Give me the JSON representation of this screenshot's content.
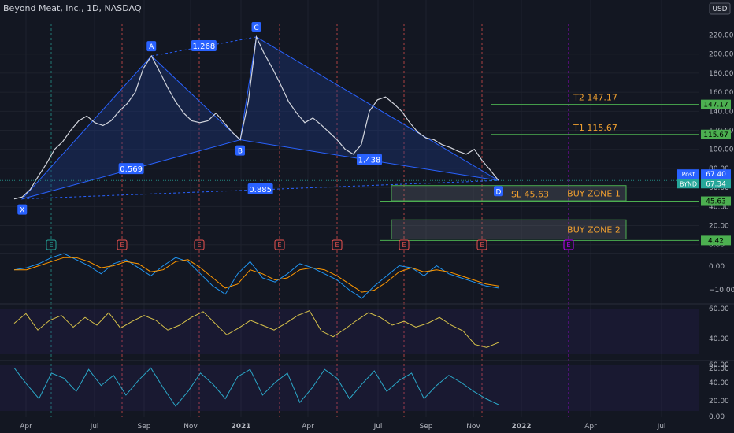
{
  "header": {
    "symbol_title": "Beyond Meat, Inc., 1D, NASDAQ",
    "currency": "USD"
  },
  "colors": {
    "background": "#131722",
    "candle_up": "#26a69a",
    "candle_down": "#ef5350",
    "pattern_line": "#2962ff",
    "pattern_fill": "#1e3a8a",
    "target_line": "#4caf50",
    "zone_label": "#f0a030",
    "macd_line": "#2196f3",
    "signal_line": "#ff9800",
    "rsi_line": "#d8c34a",
    "stoch_line": "#2ba8c8",
    "earnings_marker": "#ef5350",
    "earnings_upcoming": "#c000ff"
  },
  "chart_data": [
    {
      "type": "line",
      "title": "Beyond Meat, Inc., 1D, NASDAQ",
      "x_labels": [
        "Apr",
        "Jul",
        "Sep",
        "Nov",
        "2021",
        "Apr",
        "Jul",
        "Sep",
        "Nov",
        "2022",
        "Apr",
        "Jul"
      ],
      "y_ticks": [
        0,
        20,
        40,
        60,
        80,
        100,
        120,
        140,
        160,
        180,
        200,
        220
      ],
      "ylim": [
        -6,
        232
      ],
      "series": [
        {
          "values": [
            48,
            50,
            58,
            72,
            85,
            100,
            108,
            120,
            130,
            135,
            128,
            125,
            130,
            140,
            148,
            160,
            185,
            198,
            182,
            165,
            150,
            138,
            130,
            128,
            130,
            138,
            128,
            118,
            110,
            150,
            218,
            200,
            185,
            168,
            150,
            138,
            128,
            133,
            126,
            118,
            110,
            100,
            95,
            105,
            140,
            152,
            155,
            148,
            140,
            128,
            118,
            112,
            110,
            105,
            102,
            98,
            95,
            100,
            88,
            78,
            67.34
          ]
        }
      ],
      "harmonic_pattern": {
        "points": [
          {
            "label": "X",
            "value": 48
          },
          {
            "label": "A",
            "value": 198
          },
          {
            "label": "B",
            "value": 110
          },
          {
            "label": "C",
            "value": 218
          },
          {
            "label": "D",
            "value": 67.34
          }
        ],
        "ratios": [
          {
            "label": "1.268",
            "between": "A-C"
          },
          {
            "label": "0.569",
            "between": "X-B"
          },
          {
            "label": "1.438",
            "between": "B-D"
          },
          {
            "label": "0.885",
            "between": "X-D"
          }
        ]
      },
      "levels": [
        {
          "label": "T2 147.17",
          "value": 147.17,
          "axis_label": "147.17"
        },
        {
          "label": "T1 115.67",
          "value": 115.67,
          "axis_label": "115.67"
        },
        {
          "label": "SL 45.63",
          "value": 45.63,
          "axis_label": "45.63"
        },
        {
          "label": "",
          "value": 4.42,
          "axis_label": "4.42"
        }
      ],
      "zones": [
        {
          "label": "BUY ZONE 1",
          "top": 62,
          "bottom": 46
        },
        {
          "label": "BUY ZONE 2",
          "top": 26,
          "bottom": 6
        }
      ],
      "price_tags": [
        {
          "label": "Post",
          "value": "67.40"
        },
        {
          "label": "BYND",
          "value": "67.34"
        }
      ],
      "earnings_markers": [
        "E",
        "E",
        "E",
        "E",
        "E",
        "E",
        "E",
        "E"
      ]
    },
    {
      "type": "line",
      "y_ticks": [
        "0.00",
        "−10.00"
      ],
      "series": [
        {
          "values": [
            0,
            1,
            3,
            6,
            8,
            5,
            2,
            -2,
            3,
            5,
            1,
            -3,
            2,
            6,
            4,
            -2,
            -8,
            -12,
            -2,
            4,
            -4,
            -6,
            -2,
            3,
            1,
            -2,
            -5,
            -10,
            -14,
            -8,
            -3,
            2,
            1,
            -3,
            2,
            -2,
            -4,
            -6,
            -8,
            -9
          ]
        },
        {
          "values": [
            0,
            0,
            2,
            4,
            6,
            6,
            4,
            1,
            2,
            4,
            3,
            -1,
            0,
            4,
            5,
            1,
            -4,
            -9,
            -7,
            0,
            -2,
            -5,
            -4,
            0,
            1,
            0,
            -3,
            -7,
            -11,
            -10,
            -6,
            -1,
            1,
            -1,
            0,
            -1,
            -3,
            -5,
            -7,
            -8
          ]
        }
      ]
    },
    {
      "type": "line",
      "y_ticks": [
        "60.00",
        "40.00",
        "20.00"
      ],
      "series": [
        {
          "values": [
            52,
            62,
            45,
            55,
            60,
            48,
            58,
            50,
            63,
            47,
            54,
            60,
            55,
            45,
            50,
            58,
            64,
            52,
            40,
            47,
            55,
            50,
            45,
            52,
            60,
            65,
            44,
            38,
            46,
            55,
            63,
            58,
            50,
            54,
            48,
            52,
            58,
            50,
            44,
            30,
            27,
            32
          ]
        }
      ]
    },
    {
      "type": "line",
      "y_ticks": [
        "60.00",
        "40.00",
        "20.00",
        "0.00"
      ],
      "series": [
        {
          "values": [
            62,
            40,
            20,
            55,
            48,
            30,
            60,
            38,
            52,
            25,
            45,
            62,
            35,
            10,
            30,
            55,
            40,
            20,
            50,
            60,
            25,
            42,
            55,
            15,
            35,
            60,
            48,
            20,
            40,
            58,
            30,
            45,
            55,
            20,
            38,
            52,
            42,
            30,
            20,
            12
          ]
        }
      ]
    }
  ]
}
